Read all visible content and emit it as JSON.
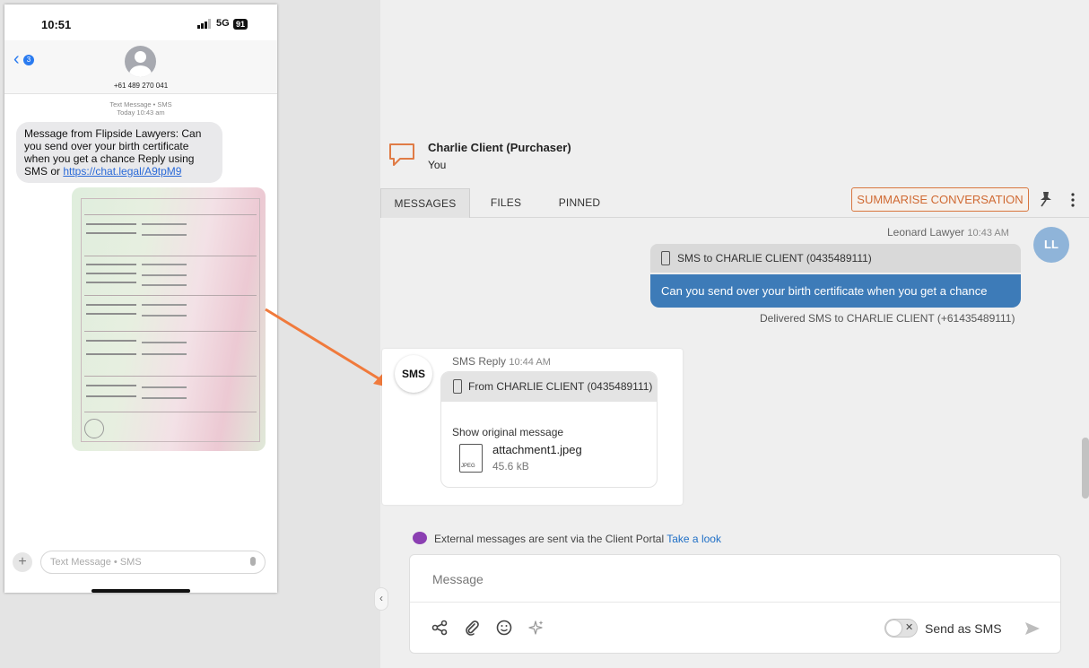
{
  "phone": {
    "time": "10:51",
    "network": "5G",
    "battery": "91",
    "back_badge": "3",
    "contact_number": "+61 489 270 041",
    "thread_type": "Text Message • SMS",
    "thread_time": "Today 10:43 am",
    "message_text": "Message from Flipside Lawyers: Can you send over your birth certificate when you get a chance Reply using SMS or ",
    "message_link": "https://chat.legal/A9tpM9",
    "input_placeholder": "Text Message • SMS",
    "plus_label": "+"
  },
  "conversation": {
    "title": "Charlie Client (Purchaser)",
    "subtitle": "You",
    "tabs": [
      "MESSAGES",
      "FILES",
      "PINNED"
    ],
    "active_tab": "MESSAGES",
    "summarise_label": "SUMMARISE CONVERSATION"
  },
  "outgoing": {
    "sender": "Leonard Lawyer",
    "time": "10:43 AM",
    "avatar_initials": "LL",
    "header": "SMS to CHARLIE CLIENT (0435489111)",
    "body": "Can you send over your birth certificate when you get a chance",
    "delivered": "Delivered SMS to CHARLIE CLIENT (+61435489111)"
  },
  "incoming": {
    "avatar_label": "SMS",
    "sender": "SMS Reply",
    "time": "10:44 AM",
    "header": "From CHARLIE CLIENT (0435489111)",
    "show_original": "Show original message",
    "file_type": "JPEG",
    "file_name": "attachment1.jpeg",
    "file_size": "45.6 kB"
  },
  "notice": {
    "text": "External messages are sent via the Client Portal",
    "link": "Take a look"
  },
  "composer": {
    "placeholder": "Message",
    "send_as_sms": "Send as SMS",
    "toggle_state": "off"
  },
  "colors": {
    "accent_blue": "#3d7bb8",
    "summarise_orange": "#d06a33",
    "arrow_orange": "#f07a3c",
    "avatar_ll": "#8fb4d9",
    "notice_purple": "#8b3fb2"
  }
}
